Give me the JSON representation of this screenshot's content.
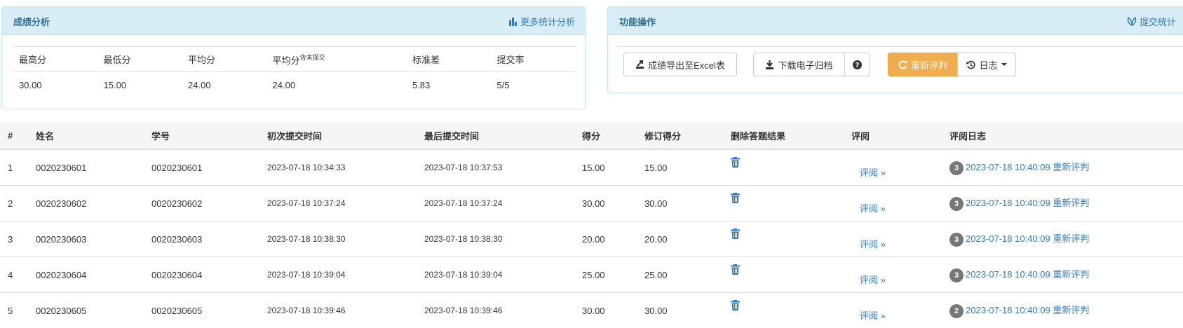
{
  "left_panel": {
    "title": "成绩分析",
    "link_label": "更多统计分析",
    "link_icon": "bar-chart-icon",
    "headers": [
      "最高分",
      "最低分",
      "平均分",
      "平均分",
      "标准差",
      "提交率"
    ],
    "avg_sup": "含末提交",
    "values": [
      "30.00",
      "15.00",
      "24.00",
      "24.00",
      "5.83",
      "5/5"
    ]
  },
  "right_panel": {
    "title": "功能操作",
    "link_label": "提交统计",
    "link_icon": "leaf-icon",
    "export_label": "成绩导出至Excel表",
    "download_label": "下载电子归档",
    "rejudge_label": "重新评判",
    "log_label": "日志"
  },
  "table": {
    "headers": [
      "#",
      "姓名",
      "学号",
      "初次提交时间",
      "最后提交时间",
      "得分",
      "修订得分",
      "删除答题结果",
      "评阅",
      "评阅日志"
    ],
    "review_label": "评阅 »",
    "rows": [
      {
        "no": "1",
        "name": "0020230601",
        "id": "0020230601",
        "first": "2023-07-18 10:34:33",
        "last": "2023-07-18 10:37:53",
        "score": "15.00",
        "revised": "15.00",
        "badge": "3",
        "log": "2023-07-18 10:40:09 重新评判"
      },
      {
        "no": "2",
        "name": "0020230602",
        "id": "0020230602",
        "first": "2023-07-18 10:37:24",
        "last": "2023-07-18 10:37:24",
        "score": "30.00",
        "revised": "30.00",
        "badge": "3",
        "log": "2023-07-18 10:40:09 重新评判"
      },
      {
        "no": "3",
        "name": "0020230603",
        "id": "0020230603",
        "first": "2023-07-18 10:38:30",
        "last": "2023-07-18 10:38:30",
        "score": "20.00",
        "revised": "20.00",
        "badge": "3",
        "log": "2023-07-18 10:40:09 重新评判"
      },
      {
        "no": "4",
        "name": "0020230604",
        "id": "0020230604",
        "first": "2023-07-18 10:39:04",
        "last": "2023-07-18 10:39:04",
        "score": "25.00",
        "revised": "25.00",
        "badge": "3",
        "log": "2023-07-18 10:40:09 重新评判"
      },
      {
        "no": "5",
        "name": "0020230605",
        "id": "0020230605",
        "first": "2023-07-18 10:39:46",
        "last": "2023-07-18 10:39:46",
        "score": "30.00",
        "revised": "30.00",
        "badge": "2",
        "log": "2023-07-18 10:40:09 重新评判"
      }
    ]
  },
  "colors": {
    "primary": "#337ab7",
    "warning": "#f0ad4e",
    "panel_head": "#d9edf7",
    "badge": "#777777"
  }
}
